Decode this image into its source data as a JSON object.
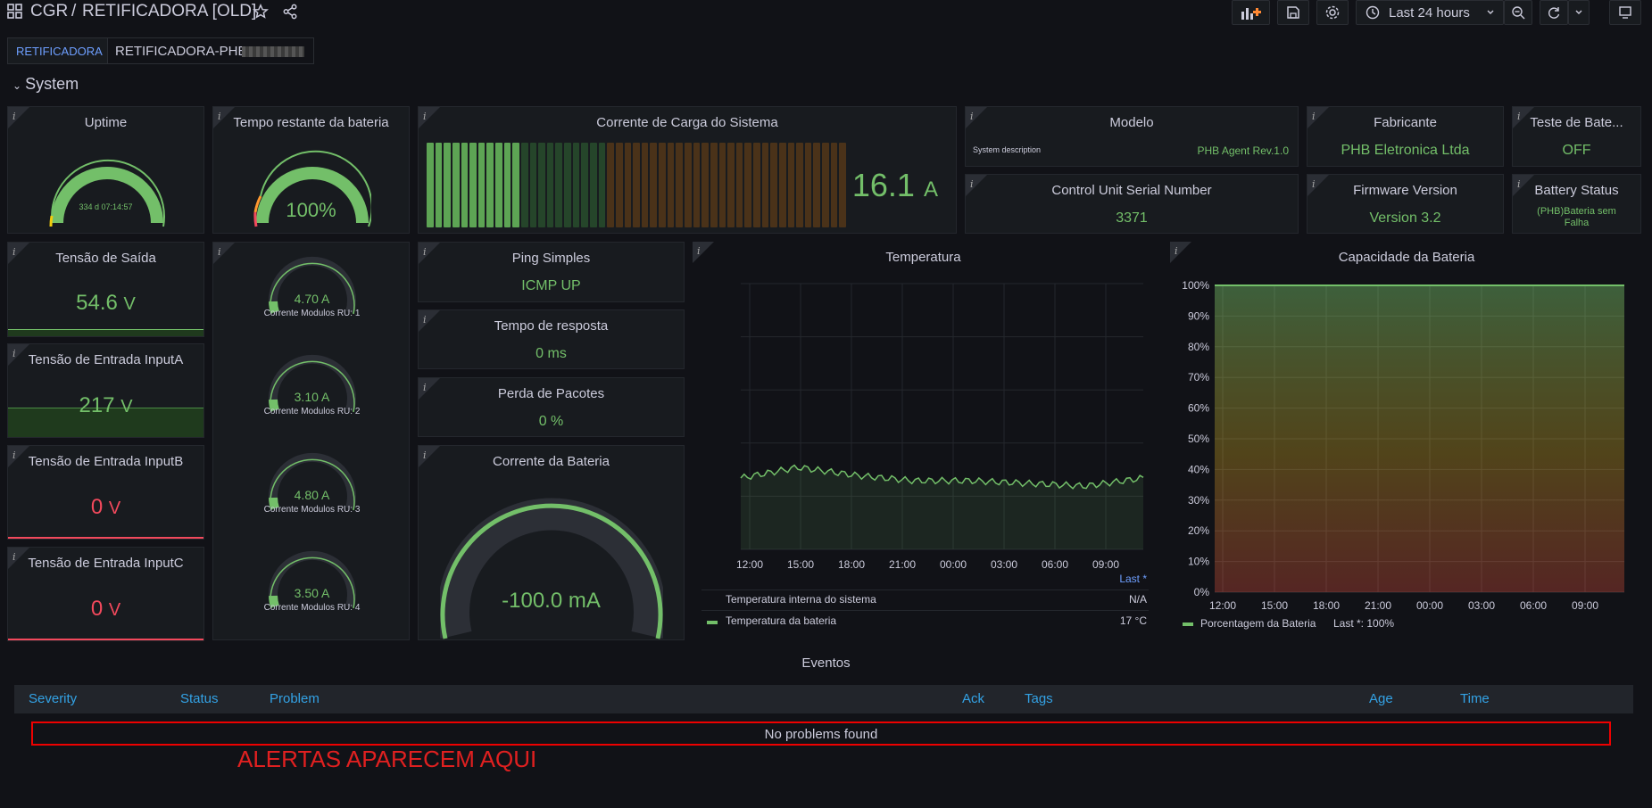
{
  "header": {
    "folder": "CGR",
    "separator": "/",
    "dashboard_title": "RETIFICADORA [OLD]",
    "time_range": "Last 24 hours"
  },
  "variables": {
    "label": "RETIFICADORA",
    "value": "RETIFICADORA-PHB-"
  },
  "row_title": "System",
  "panels": {
    "uptime": {
      "title": "Uptime",
      "value": "334 d 07:14:57"
    },
    "battery_time": {
      "title": "Tempo restante da bateria",
      "value": "100%"
    },
    "load_current": {
      "title": "Corrente de Carga do Sistema",
      "value": "16.1",
      "unit": "A",
      "fraction": 0.23
    },
    "model": {
      "title": "Modelo",
      "label": "System description",
      "value": "PHB Agent Rev.1.0"
    },
    "manufacturer": {
      "title": "Fabricante",
      "value": "PHB Eletronica Ltda"
    },
    "battery_test": {
      "title": "Teste de Bate...",
      "value": "OFF"
    },
    "serial": {
      "title": "Control Unit Serial Number",
      "value": "3371"
    },
    "firmware": {
      "title": "Firmware Version",
      "value": "Version 3.2"
    },
    "battery_status": {
      "title": "Battery Status",
      "value": "(PHB)Bateria sem Falha"
    },
    "output_voltage": {
      "title": "Tensão de Saída",
      "value": "54.6",
      "unit": "V"
    },
    "input_a": {
      "title": "Tensão de Entrada InputA",
      "value": "217",
      "unit": "V"
    },
    "input_b": {
      "title": "Tensão de Entrada InputB",
      "value": "0",
      "unit": "V"
    },
    "input_c": {
      "title": "Tensão de Entrada InputC",
      "value": "0",
      "unit": "V"
    },
    "modules": [
      {
        "value": "4.70 A",
        "label": "Corrente Modulos RU: 1"
      },
      {
        "value": "3.10 A",
        "label": "Corrente Modulos RU: 2"
      },
      {
        "value": "4.80 A",
        "label": "Corrente Modulos RU: 3"
      },
      {
        "value": "3.50 A",
        "label": "Corrente Modulos RU: 4"
      }
    ],
    "ping": {
      "title": "Ping Simples",
      "value": "ICMP UP"
    },
    "response": {
      "title": "Tempo de resposta",
      "value": "0 ms"
    },
    "packet_loss": {
      "title": "Perda de Pacotes",
      "value": "0 %"
    },
    "battery_current": {
      "title": "Corrente da Bateria",
      "value": "-100.0 mA"
    },
    "temperature": {
      "title": "Temperatura",
      "legend_header": "Last *",
      "legend": [
        {
          "name": "Temperatura interna do sistema",
          "value": "N/A"
        },
        {
          "name": "Temperatura da bateria",
          "value": "17 °C"
        }
      ]
    },
    "capacity": {
      "title": "Capacidade da Bateria",
      "legend": "Porcentagem da Bateria",
      "legend_value": "Last *: 100%"
    }
  },
  "chart_data": [
    {
      "type": "line",
      "title": "Temperatura",
      "x": [
        "12:00",
        "15:00",
        "18:00",
        "21:00",
        "00:00",
        "03:00",
        "06:00",
        "09:00"
      ],
      "series": [
        {
          "name": "Temperatura da bateria",
          "values": [
            17,
            17.4,
            17.1,
            16.9,
            16.9,
            16.8,
            16.7,
            17
          ]
        }
      ],
      "color": "#73bf69"
    },
    {
      "type": "area",
      "title": "Capacidade da Bateria",
      "x": [
        "12:00",
        "15:00",
        "18:00",
        "21:00",
        "00:00",
        "03:00",
        "06:00",
        "09:00"
      ],
      "y_ticks": [
        "0%",
        "10%",
        "20%",
        "30%",
        "40%",
        "50%",
        "60%",
        "70%",
        "80%",
        "90%",
        "100%"
      ],
      "ylim": [
        0,
        100
      ],
      "series": [
        {
          "name": "Porcentagem da Bateria",
          "values": [
            100,
            100,
            100,
            100,
            100,
            100,
            100,
            100
          ]
        }
      ],
      "color": "#73bf69"
    }
  ],
  "events": {
    "title": "Eventos",
    "columns": [
      "Severity",
      "Status",
      "Problem",
      "Ack",
      "Tags",
      "Age",
      "Time"
    ],
    "empty_text": "No problems found",
    "annotation": "ALERTAS APARECEM AQUI"
  }
}
